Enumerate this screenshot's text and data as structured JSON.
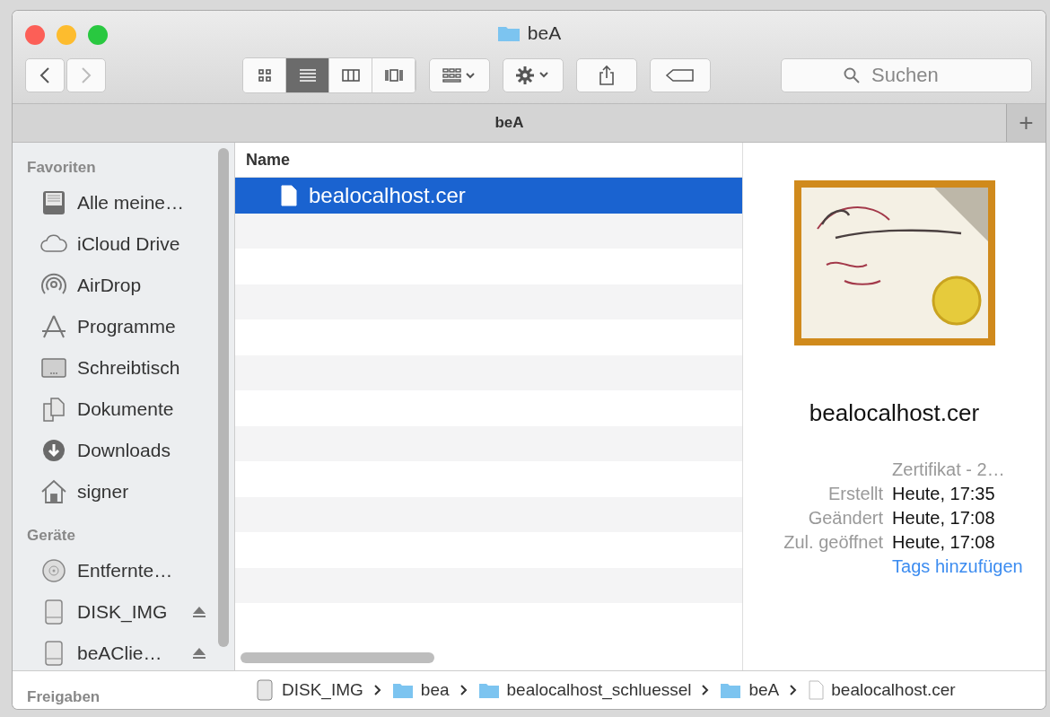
{
  "window": {
    "title": "beA"
  },
  "toolbar": {
    "views": [
      {
        "kind": "icons",
        "selected": false
      },
      {
        "kind": "list",
        "selected": true
      },
      {
        "kind": "columns",
        "selected": false
      },
      {
        "kind": "gallery",
        "selected": false
      }
    ],
    "search": {
      "placeholder": "Suchen"
    }
  },
  "tab_bar": {
    "title": "beA",
    "add_label": "+"
  },
  "sidebar": {
    "sections": [
      {
        "title": "Favoriten",
        "items": [
          {
            "kind": "allfiles",
            "label": "Alle meine…",
            "eject": false
          },
          {
            "kind": "cloud",
            "label": "iCloud Drive",
            "eject": false
          },
          {
            "kind": "airdrop",
            "label": "AirDrop",
            "eject": false
          },
          {
            "kind": "apps",
            "label": "Programme",
            "eject": false
          },
          {
            "kind": "desktop",
            "label": "Schreibtisch",
            "eject": false
          },
          {
            "kind": "docs",
            "label": "Dokumente",
            "eject": false
          },
          {
            "kind": "downloads",
            "label": "Downloads",
            "eject": false
          },
          {
            "kind": "home",
            "label": "signer",
            "eject": false
          }
        ]
      },
      {
        "title": "Geräte",
        "items": [
          {
            "kind": "disc",
            "label": "Entfernte…",
            "eject": false
          },
          {
            "kind": "disk",
            "label": "DISK_IMG",
            "eject": true
          },
          {
            "kind": "disk",
            "label": "beAClie…",
            "eject": true
          }
        ]
      },
      {
        "title": "Freigaben"
      }
    ]
  },
  "file_list": {
    "column": "Name",
    "rows": [
      {
        "name": "bealocalhost.cer",
        "selected": true
      }
    ]
  },
  "preview": {
    "name": "bealocalhost.cer",
    "kind": "Zertifikat - 2…",
    "details": [
      {
        "label": "Erstellt",
        "value": "Heute, 17:35"
      },
      {
        "label": "Geändert",
        "value": "Heute, 17:08"
      },
      {
        "label": "Zul. geöffnet",
        "value": "Heute, 17:08"
      }
    ],
    "tags_link": "Tags hinzufügen"
  },
  "path_bar": [
    {
      "kind": "disk",
      "label": "DISK_IMG"
    },
    {
      "kind": "folder",
      "label": "bea"
    },
    {
      "kind": "folder",
      "label": "bealocalhost_schluessel"
    },
    {
      "kind": "folder",
      "label": "beA"
    },
    {
      "kind": "file",
      "label": "bealocalhost.cer"
    }
  ]
}
